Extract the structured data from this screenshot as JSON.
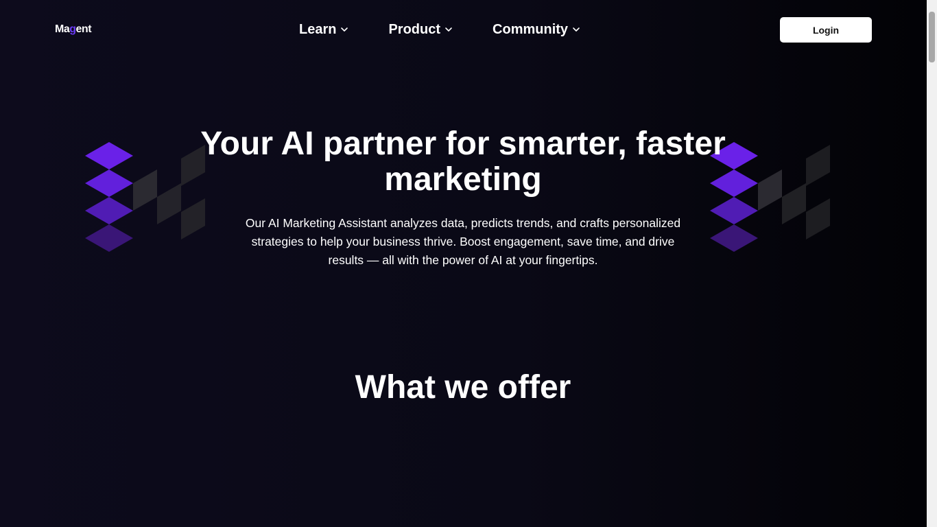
{
  "brand": {
    "name_prefix": "Ma",
    "name_accent": "g",
    "name_suffix": "ent",
    "accent_color": "#6b3cf5"
  },
  "nav": {
    "items": [
      {
        "label": "Learn",
        "icon": "chevron-down-icon"
      },
      {
        "label": "Product",
        "icon": "chevron-down-icon"
      },
      {
        "label": "Community",
        "icon": "chevron-down-icon"
      }
    ],
    "login_label": "Login"
  },
  "hero": {
    "title": "Your AI partner for smarter, faster marketing",
    "description": "Our AI Marketing Assistant analyzes data, predicts trends, and crafts personalized strategies to help your business thrive. Boost engagement, save time, and drive results — all with the power of AI at your fingertips."
  },
  "offer": {
    "title": "What we offer"
  },
  "colors": {
    "background": "#0b0a17",
    "purple_bright": "#6a21e8",
    "purple_mid": "#5a1cc4",
    "purple_dark": "#3a1677",
    "cube_gray": "#2b2a31"
  }
}
